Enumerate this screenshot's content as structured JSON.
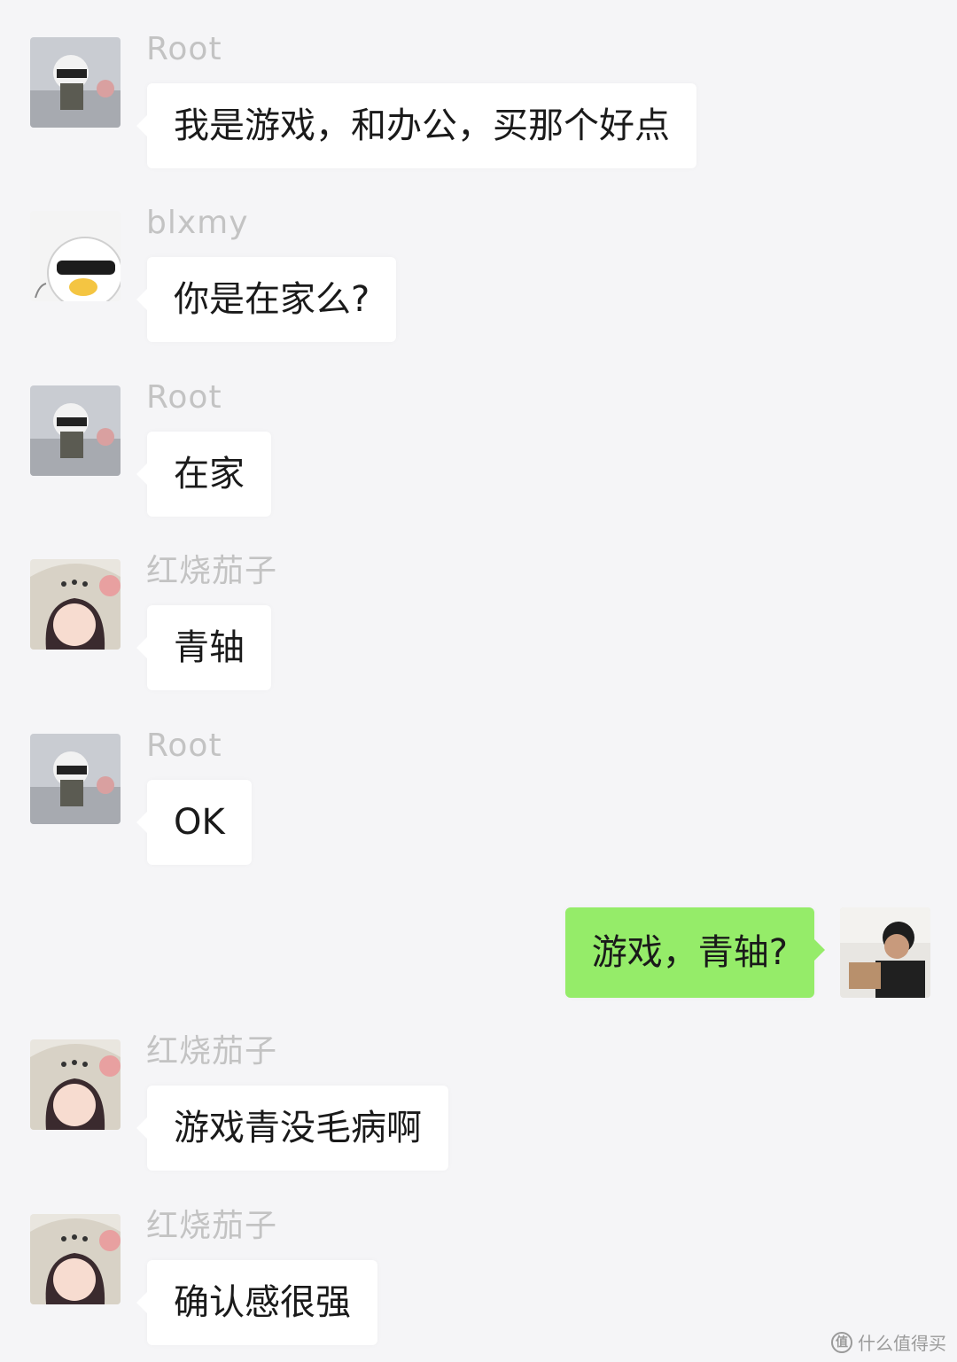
{
  "messages": [
    {
      "sender": "Root",
      "avatar": "user-root",
      "text": "我是游戏，和办公，买那个好点"
    },
    {
      "sender": "blxmy",
      "avatar": "user-blxmy",
      "text": "你是在家么?"
    },
    {
      "sender": "Root",
      "avatar": "user-root",
      "text": "在家"
    },
    {
      "sender": "红烧茄子",
      "avatar": "user-hongshaoqiezi",
      "text": "青轴"
    },
    {
      "sender": "Root",
      "avatar": "user-root",
      "text": "OK"
    },
    {
      "sender": "",
      "avatar": "self",
      "text": "游戏，青轴?",
      "self": true
    },
    {
      "sender": "红烧茄子",
      "avatar": "user-hongshaoqiezi",
      "text": "游戏青没毛病啊"
    },
    {
      "sender": "红烧茄子",
      "avatar": "user-hongshaoqiezi",
      "text": "确认感很强"
    }
  ],
  "watermark": {
    "icon": "值",
    "text": "什么值得买"
  },
  "colors": {
    "background": "#f5f5f7",
    "bubble_other": "#ffffff",
    "bubble_self": "#95ec69",
    "sender_name": "#c3c3c3"
  }
}
